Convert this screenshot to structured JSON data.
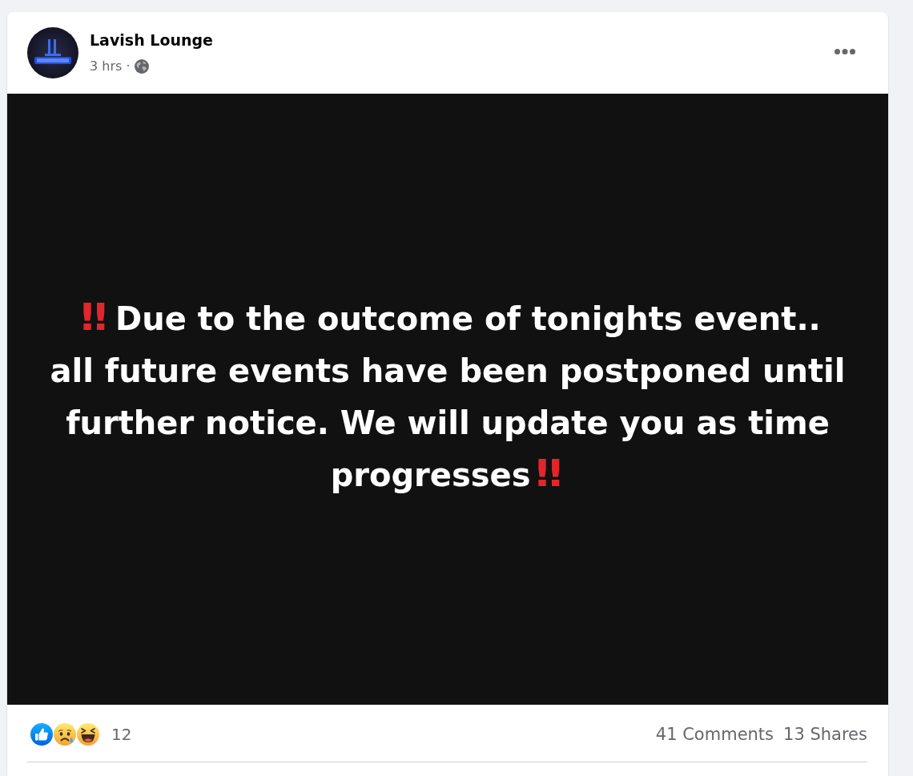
{
  "post": {
    "author": "Lavish Lounge",
    "time": "3 hrs ·",
    "text_segments": [
      {
        "kind": "emoji",
        "text": "‼"
      },
      {
        "kind": "plain",
        "text": "Due to the outcome of tonights event.. all future events have been postponed until further notice. We will update you as time progresses"
      },
      {
        "kind": "emoji",
        "text": "‼"
      }
    ]
  },
  "footer": {
    "reactions": [
      {
        "kind": "like"
      },
      {
        "kind": "sad"
      },
      {
        "kind": "haha"
      }
    ],
    "reaction_count": "12",
    "comments": "41 Comments",
    "shares": "13 Shares"
  }
}
